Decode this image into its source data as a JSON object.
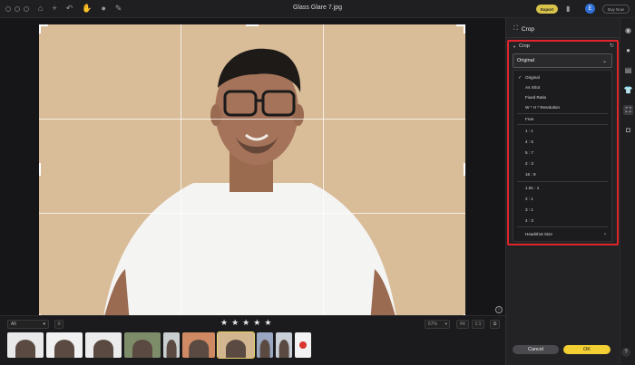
{
  "window": {
    "title": "Glass Glare 7.jpg",
    "export_label": "Export",
    "avatar_initial": "E",
    "buy_now_label": "Buy Now"
  },
  "toolbar_icons": [
    "home-icon",
    "plus-icon",
    "undo-icon",
    "hand-icon",
    "brush-icon",
    "pencil-icon"
  ],
  "filmstrip": {
    "filter_value": "All",
    "rating_stars": 5,
    "zoom_value": "67%",
    "fit_label": "Fit",
    "one_to_one_label": "1:1",
    "selected_index": 6,
    "thumbnail_colors": [
      "#e9e9e9",
      "#f1f1f1",
      "#ececec",
      "#7d8d6a",
      "#c9cfcf",
      "#cf8a63",
      "#d2b690",
      "#9aa7c2",
      "#c9d0d7",
      "#f3f3f3"
    ]
  },
  "panel": {
    "title": "Crop",
    "section_title": "Crop",
    "dropdown_value": "Original",
    "menu_items": [
      {
        "label": "Original",
        "checked": true
      },
      {
        "label": "As Shot"
      },
      {
        "label": "Fixed Ratio"
      },
      {
        "label": "W * H * Resolution"
      },
      {
        "label": "Free"
      },
      {
        "label": "1 : 1"
      },
      {
        "label": "4 : 5"
      },
      {
        "label": "5 : 7"
      },
      {
        "label": "2 : 3"
      },
      {
        "label": "16 : 9"
      },
      {
        "label": "1.91 : 1"
      },
      {
        "label": "2 : 1"
      },
      {
        "label": "3 : 1"
      },
      {
        "label": "4 : 3"
      },
      {
        "label": "Headshot Size",
        "submenu": true
      }
    ],
    "cancel_label": "Cancel",
    "ok_label": "OK"
  },
  "side_tools": [
    "eye-icon",
    "drop-icon",
    "layers-icon",
    "shirt-icon",
    "crop-icon",
    "camera-icon"
  ],
  "help_label": "?",
  "colors": {
    "accent_yellow": "#f2cf33",
    "highlight_red": "#e0262b",
    "background_tan": "#d7b994"
  }
}
